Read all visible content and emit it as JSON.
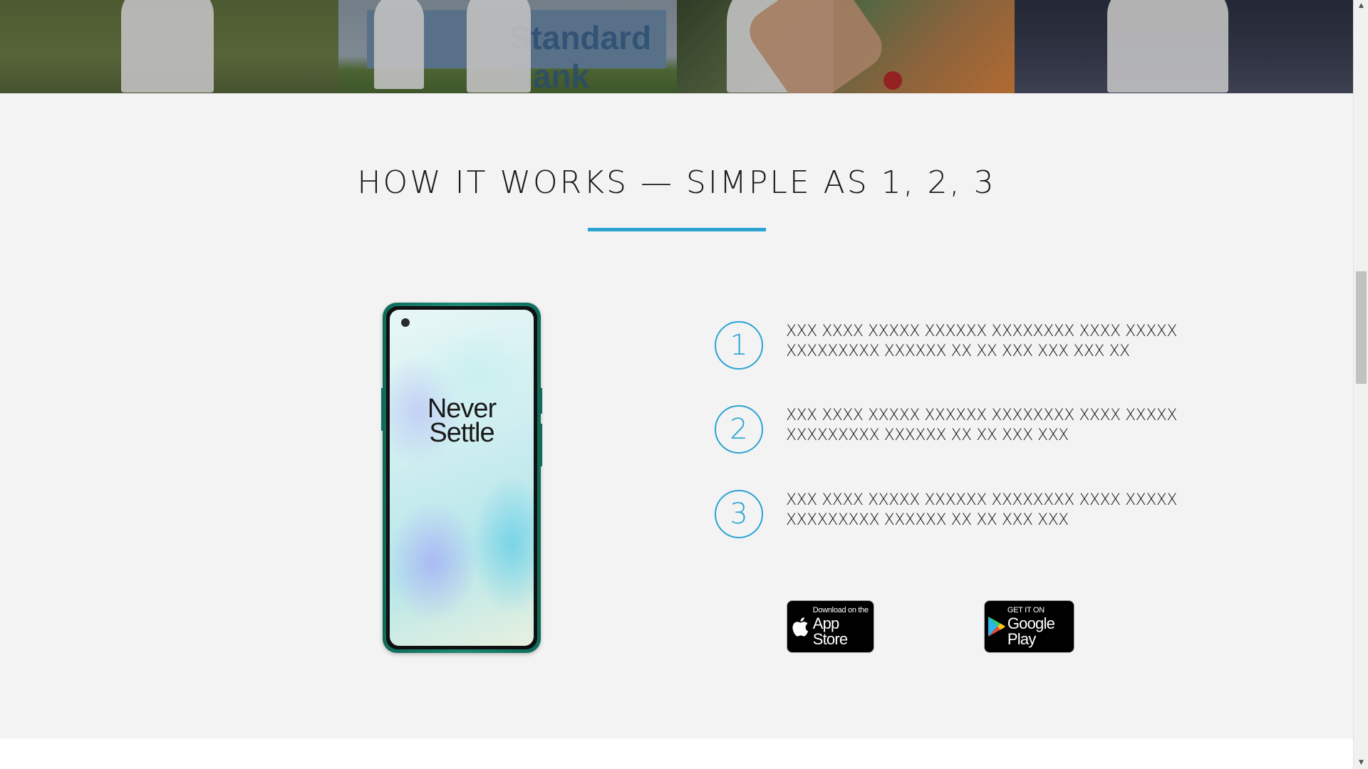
{
  "photo_strip": {
    "banner_text": "Standard Bank"
  },
  "how_it_works": {
    "title": "HOW IT WORKS — SIMPLE AS 1, 2, 3",
    "accent_color": "#2aa3d3",
    "phone": {
      "slogan_line1": "Never",
      "slogan_line2": "Settle"
    },
    "steps": [
      {
        "number": "1",
        "text": "XXX XXXX XXXXX XXXXXX XXXXXXXX XXXX XXXXX XXXXXXXXX XXXXXX XX XX XXX XXX XXX XX"
      },
      {
        "number": "2",
        "text": "XXX XXXX XXXXX XXXXXX XXXXXXXX XXXX XXXXX XXXXXXXXX XXXXXX XX XX XXX XXX"
      },
      {
        "number": "3",
        "text": "XXX XXXX XXXXX XXXXXX XXXXXXXX XXXX XXXXX XXXXXXXXX XXXXXX XX XX XXX XXX"
      }
    ],
    "badges": {
      "apple": {
        "small": "Download on the",
        "big": "App Store",
        "icon": "apple-icon"
      },
      "google": {
        "small": "GET IT ON",
        "big": "Google Play",
        "icon": "google-play-icon"
      }
    }
  },
  "scrollbar": {
    "up_arrow": "▲",
    "down_arrow": "▼"
  }
}
